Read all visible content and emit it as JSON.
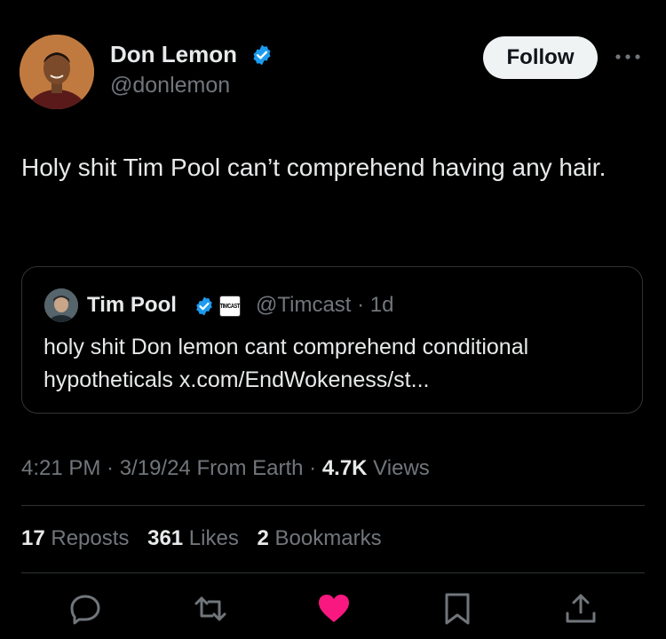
{
  "tweet": {
    "author": {
      "name": "Don Lemon",
      "handle": "@donlemon",
      "verified": true
    },
    "follow_label": "Follow",
    "text": "Holy shit Tim Pool can’t comprehend having any hair.",
    "quote": {
      "author_name": "Tim Pool",
      "verified": true,
      "affiliate_badge_text": "TIMCAST",
      "handle_time": "@Timcast · 1d",
      "text": "holy shit Don lemon cant comprehend conditional hypotheticals x.com/EndWokeness/st..."
    },
    "meta": {
      "time_date": "4:21 PM · 3/19/24 From Earth · ",
      "views_count": "4.7K",
      "views_label": " Views"
    },
    "stats": {
      "reposts_count": "17",
      "reposts_label": " Reposts",
      "likes_count": "361",
      "likes_label": " Likes",
      "bookmarks_count": "2",
      "bookmarks_label": " Bookmarks"
    },
    "actions": {
      "reply_icon": "reply-icon",
      "repost_icon": "repost-icon",
      "like_icon": "heart-icon",
      "like_active": true,
      "bookmark_icon": "bookmark-icon",
      "share_icon": "share-icon"
    }
  },
  "colors": {
    "background": "#000000",
    "text_primary": "#e7e9ea",
    "text_secondary": "#71767b",
    "verified_blue": "#1d9bf0",
    "like_pink": "#f91880",
    "divider": "#2f3336",
    "follow_bg": "#eff3f4"
  }
}
